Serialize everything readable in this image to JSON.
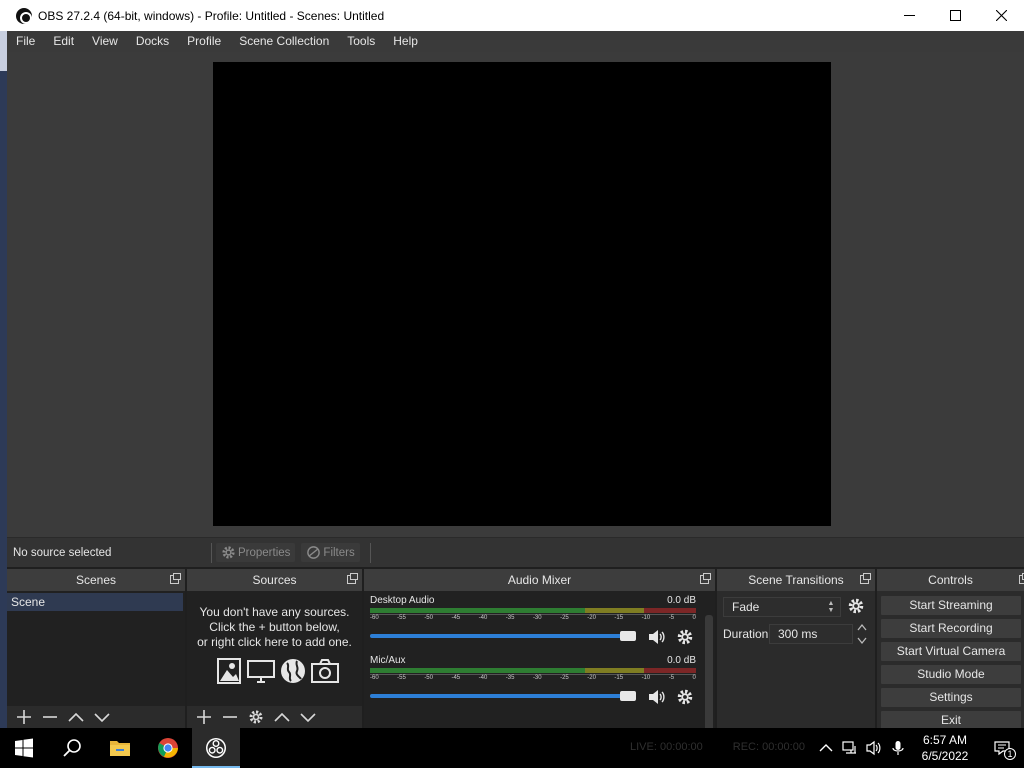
{
  "window": {
    "title": "OBS 27.2.4 (64-bit, windows) - Profile: Untitled - Scenes: Untitled"
  },
  "menu": [
    "File",
    "Edit",
    "View",
    "Docks",
    "Profile",
    "Scene Collection",
    "Tools",
    "Help"
  ],
  "source_toolbar": {
    "status": "No source selected",
    "properties_label": "Properties",
    "filters_label": "Filters"
  },
  "docks": {
    "scenes": {
      "title": "Scenes",
      "items": [
        "Scene"
      ]
    },
    "sources": {
      "title": "Sources",
      "empty_line1": "You don't have any sources.",
      "empty_line2": "Click the + button below,",
      "empty_line3": "or right click here to add one."
    },
    "mixer": {
      "title": "Audio Mixer",
      "channels": [
        {
          "name": "Desktop Audio",
          "db": "0.0 dB",
          "volume_percent": 100
        },
        {
          "name": "Mic/Aux",
          "db": "0.0 dB",
          "volume_percent": 100
        }
      ],
      "scale": [
        "-60",
        "-55",
        "-50",
        "-45",
        "-40",
        "-35",
        "-30",
        "-25",
        "-20",
        "-15",
        "-10",
        "-5",
        "0"
      ]
    },
    "transitions": {
      "title": "Scene Transitions",
      "selected": "Fade",
      "duration_label": "Duration",
      "duration_value": "300 ms"
    },
    "controls": {
      "title": "Controls",
      "buttons": [
        "Start Streaming",
        "Start Recording",
        "Start Virtual Camera",
        "Studio Mode",
        "Settings",
        "Exit"
      ]
    }
  },
  "taskbar": {
    "time": "6:57 AM",
    "date": "6/5/2022",
    "status_live": "LIVE: 00:00:00",
    "status_rec": "REC: 00:00:00",
    "notification_count": "1"
  },
  "colors": {
    "accent": "#2d7fd6",
    "selected_scene": "#2f3a51",
    "dock_header": "#3d3d3d",
    "panel_bg": "#212121"
  }
}
